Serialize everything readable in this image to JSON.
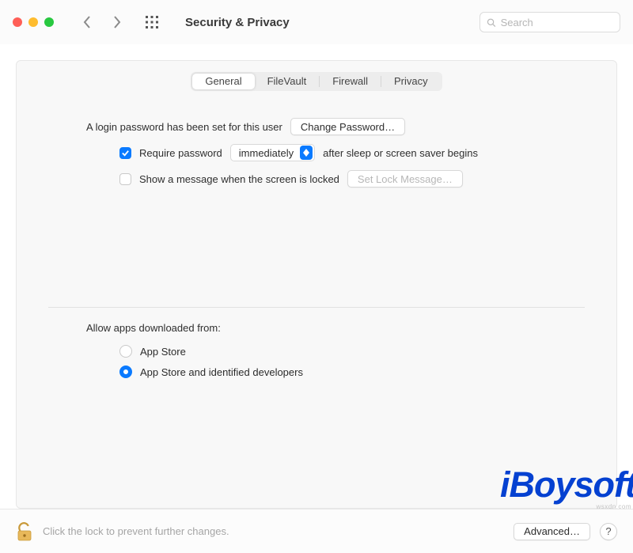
{
  "header": {
    "title": "Security & Privacy",
    "search_placeholder": "Search"
  },
  "tabs": {
    "general": "General",
    "filevault": "FileVault",
    "firewall": "Firewall",
    "privacy": "Privacy"
  },
  "login_section": {
    "password_set_text": "A login password has been set for this user",
    "change_password_btn": "Change Password…",
    "require_password_label": "Require password",
    "require_password_checked": true,
    "delay_value": "immediately",
    "after_text": "after sleep or screen saver begins",
    "show_message_label": "Show a message when the screen is locked",
    "show_message_checked": false,
    "set_lock_message_btn": "Set Lock Message…"
  },
  "allow_section": {
    "title": "Allow apps downloaded from:",
    "options": {
      "appstore": "App Store",
      "identified": "App Store and identified developers"
    },
    "selected": "identified"
  },
  "footer": {
    "lock_text": "Click the lock to prevent further changes.",
    "advanced_btn": "Advanced…",
    "help": "?"
  },
  "watermark": {
    "brand": "iBoysoft",
    "site": "wsxdn.com"
  }
}
